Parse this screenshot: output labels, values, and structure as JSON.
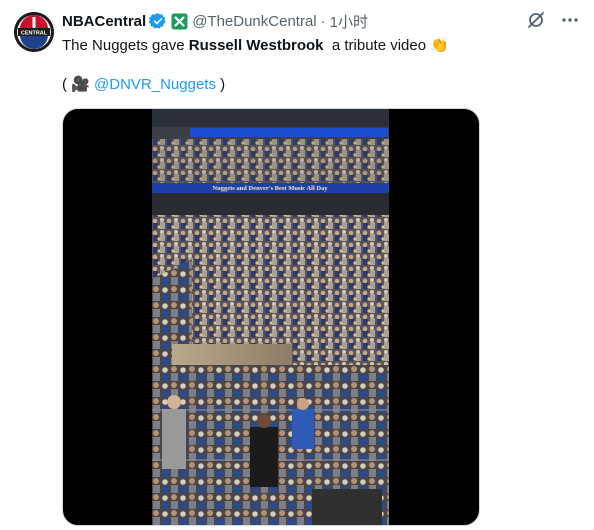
{
  "author": {
    "display_name": "NBACentral",
    "handle": "@TheDunkCentral",
    "separator": "·",
    "time": "1小时",
    "avatar_text": "CENTRAL"
  },
  "tweet": {
    "text_before": "The Nuggets gave ",
    "text_bold": "Russell Westbrook",
    "text_after": "  a tribute video ",
    "emoji_clap": "👏",
    "credit_open": "( ",
    "credit_camera": "🎥",
    "credit_mention": " @DNVR_Nuggets",
    "credit_close": " )"
  },
  "media": {
    "banner_text": "Nuggets and Denver's Best Music All Day"
  },
  "colors": {
    "link": "#1d9bf0",
    "verified": "#1d9bf0",
    "affiliate_badge": "#1a9c5b",
    "secondary_text": "#536471"
  }
}
